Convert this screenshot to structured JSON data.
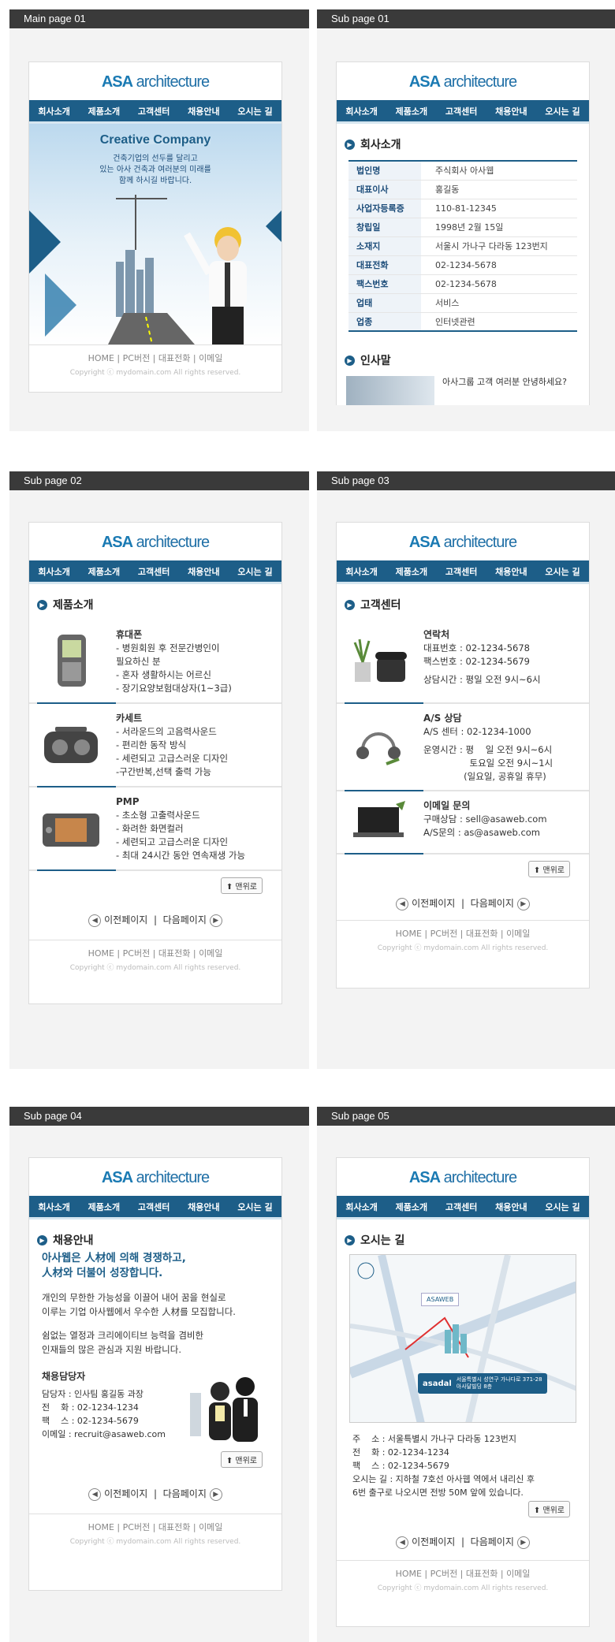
{
  "labels": {
    "p1": "Main page 01",
    "p2": "Sub page 01",
    "p3": "Sub page 02",
    "p4": "Sub page 03",
    "p5": "Sub page 04",
    "p6": "Sub page 05"
  },
  "logo": {
    "a": "ASA",
    "b": "architecture"
  },
  "nav": [
    "회사소개",
    "제품소개",
    "고객센터",
    "채용안내",
    "오시는 길"
  ],
  "footer": {
    "links": "HOME  |  PC버전  |  대표전화  |  이메일",
    "copyright": "Copyright ⓒ mydomain.com All rights reserved."
  },
  "pager": {
    "prev": "이전페이지",
    "sep": "|",
    "next": "다음페이지"
  },
  "top_button": "맨위로",
  "main": {
    "hero_title": "Creative Company",
    "hero_text": "건축기업의 선두를 달리고\n있는 아사 건축과 여러분의 미래를\n함께 하시길 바랍니다."
  },
  "company": {
    "title": "회사소개",
    "rows": [
      {
        "k": "법인명",
        "v": "주식회사 아사웹"
      },
      {
        "k": "대표이사",
        "v": "홍길동"
      },
      {
        "k": "사업자등록증",
        "v": "110-81-12345"
      },
      {
        "k": "창립일",
        "v": "1998년 2월 15일"
      },
      {
        "k": "소재지",
        "v": "서울시 가나구 다라동 123번지"
      },
      {
        "k": "대표전화",
        "v": "02-1234-5678"
      },
      {
        "k": "팩스번호",
        "v": "02-1234-5678"
      },
      {
        "k": "업태",
        "v": "서비스"
      },
      {
        "k": "업종",
        "v": "인터넷관련"
      }
    ],
    "greeting_title": "인사말",
    "greeting_text": "아사그룹 고객 여러분 안녕하세요?"
  },
  "products": {
    "title": "제품소개",
    "items": [
      {
        "name": "휴대폰",
        "lines": [
          "- 병원회원 후 전문간병인이",
          "  필요하신 분",
          "- 혼자 생활하시는 어르신",
          "- 장기요양보험대상자(1~3급)"
        ]
      },
      {
        "name": "카세트",
        "lines": [
          "- 서라운드의 고음력사운드",
          "- 편리한 동작 방식",
          "- 세련되고 고급스러운 디자인",
          "-구간반복,선택 출력 가능"
        ]
      },
      {
        "name": "PMP",
        "lines": [
          "- 초소형 고출력사운드",
          "- 화려한 화면컬러",
          "- 세련되고 고급스러운 디자인",
          "- 최대 24시간 동안 연속재생 가능"
        ]
      }
    ]
  },
  "support": {
    "title": "고객센터",
    "items": [
      {
        "name": "연락처",
        "lines": [
          "대표번호 : 02-1234-5678",
          "팩스번호 : 02-1234-5679",
          "",
          "상담시간 : 평일 오전 9시~6시"
        ]
      },
      {
        "name": "A/S 상담",
        "lines": [
          "A/S 센터 : 02-1234-1000",
          "",
          "운영시간 : 평    일 오전 9시~6시",
          "                토요일 오전 9시~1시",
          "              (일요일, 공휴일 휴무)"
        ]
      },
      {
        "name": "이메일 문의",
        "lines": [
          "구매상담 : sell@asaweb.com",
          "A/S문의 : as@asaweb.com"
        ]
      }
    ]
  },
  "recruit": {
    "title": "채용안내",
    "headline": "아사웹은 人材에 의해 경쟁하고,\n人材와 더불어 성장합니다.",
    "para1": "개인의 무한한 가능성을 이끌어 내어 꿈을 현실로\n이루는 기업 아사웹에서 우수한 人材를 모집합니다.",
    "para2": "쉼없는 열정과 크리에이티브 능력을 겸비한\n인재들의 많은 관심과 지원 바랍니다.",
    "contact_title": "채용담당자",
    "contact_lines": [
      "담당자 : 인사팀 홍길동 과장",
      "전    화 : 02-1234-1234",
      "팩    스 : 02-1234-5679",
      "이메일 : recruit@asaweb.com"
    ]
  },
  "location": {
    "title": "오시는 길",
    "map_brand": "ASAWEB",
    "map_badge": "asadal",
    "map_badge_text": "서울특별시 성연구 가나다로 371-28\n아사달빌딩 8층",
    "lines": [
      "주    소 : 서울특별시 가나구 다라동 123번지",
      "전    화 : 02-1234-1234",
      "팩    스 : 02-1234-5679",
      "오시는 길 : 지하철 7호선 아사웹 역에서 내리신 후",
      "6번 출구로 나오시면 전방 50M 앞에 있습니다."
    ]
  },
  "colors": {
    "accent": "#1d5e88",
    "header": "#3a3a3a",
    "panel": "#f3f3f3"
  }
}
